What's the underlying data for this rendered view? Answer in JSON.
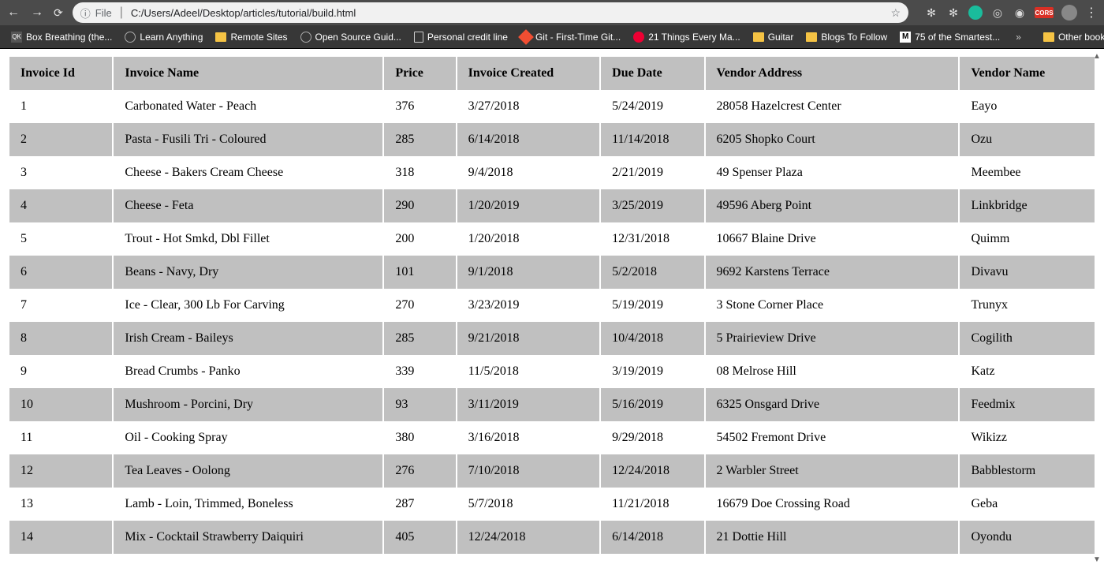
{
  "browser": {
    "url_info_icon": "ⓘ",
    "url_source_label": "File",
    "url": "C:/Users/Adeel/Desktop/articles/tutorial/build.html"
  },
  "bookmarks": {
    "items": [
      {
        "label": "Box Breathing (the...",
        "icon": "qk"
      },
      {
        "label": "Learn Anything",
        "icon": "circle"
      },
      {
        "label": "Remote Sites",
        "icon": "folder"
      },
      {
        "label": "Open Source Guid...",
        "icon": "circle"
      },
      {
        "label": "Personal credit line",
        "icon": "page"
      },
      {
        "label": "Git - First-Time Git...",
        "icon": "git"
      },
      {
        "label": "21 Things Every Ma...",
        "icon": "cc"
      },
      {
        "label": "Guitar",
        "icon": "folder"
      },
      {
        "label": "Blogs To Follow",
        "icon": "folder"
      },
      {
        "label": "75 of the Smartest...",
        "icon": "m"
      }
    ],
    "other": "Other bookmarks"
  },
  "table": {
    "headers": [
      "Invoice Id",
      "Invoice Name",
      "Price",
      "Invoice Created",
      "Due Date",
      "Vendor Address",
      "Vendor Name"
    ],
    "rows": [
      [
        "1",
        "Carbonated Water - Peach",
        "376",
        "3/27/2018",
        "5/24/2019",
        "28058 Hazelcrest Center",
        "Eayo"
      ],
      [
        "2",
        "Pasta - Fusili Tri - Coloured",
        "285",
        "6/14/2018",
        "11/14/2018",
        "6205 Shopko Court",
        "Ozu"
      ],
      [
        "3",
        "Cheese - Bakers Cream Cheese",
        "318",
        "9/4/2018",
        "2/21/2019",
        "49 Spenser Plaza",
        "Meembee"
      ],
      [
        "4",
        "Cheese - Feta",
        "290",
        "1/20/2019",
        "3/25/2019",
        "49596 Aberg Point",
        "Linkbridge"
      ],
      [
        "5",
        "Trout - Hot Smkd, Dbl Fillet",
        "200",
        "1/20/2018",
        "12/31/2018",
        "10667 Blaine Drive",
        "Quimm"
      ],
      [
        "6",
        "Beans - Navy, Dry",
        "101",
        "9/1/2018",
        "5/2/2018",
        "9692 Karstens Terrace",
        "Divavu"
      ],
      [
        "7",
        "Ice - Clear, 300 Lb For Carving",
        "270",
        "3/23/2019",
        "5/19/2019",
        "3 Stone Corner Place",
        "Trunyx"
      ],
      [
        "8",
        "Irish Cream - Baileys",
        "285",
        "9/21/2018",
        "10/4/2018",
        "5 Prairieview Drive",
        "Cogilith"
      ],
      [
        "9",
        "Bread Crumbs - Panko",
        "339",
        "11/5/2018",
        "3/19/2019",
        "08 Melrose Hill",
        "Katz"
      ],
      [
        "10",
        "Mushroom - Porcini, Dry",
        "93",
        "3/11/2019",
        "5/16/2019",
        "6325 Onsgard Drive",
        "Feedmix"
      ],
      [
        "11",
        "Oil - Cooking Spray",
        "380",
        "3/16/2018",
        "9/29/2018",
        "54502 Fremont Drive",
        "Wikizz"
      ],
      [
        "12",
        "Tea Leaves - Oolong",
        "276",
        "7/10/2018",
        "12/24/2018",
        "2 Warbler Street",
        "Babblestorm"
      ],
      [
        "13",
        "Lamb - Loin, Trimmed, Boneless",
        "287",
        "5/7/2018",
        "11/21/2018",
        "16679 Doe Crossing Road",
        "Geba"
      ],
      [
        "14",
        "Mix - Cocktail Strawberry Daiquiri",
        "405",
        "12/24/2018",
        "6/14/2018",
        "21 Dottie Hill",
        "Oyondu"
      ]
    ]
  }
}
